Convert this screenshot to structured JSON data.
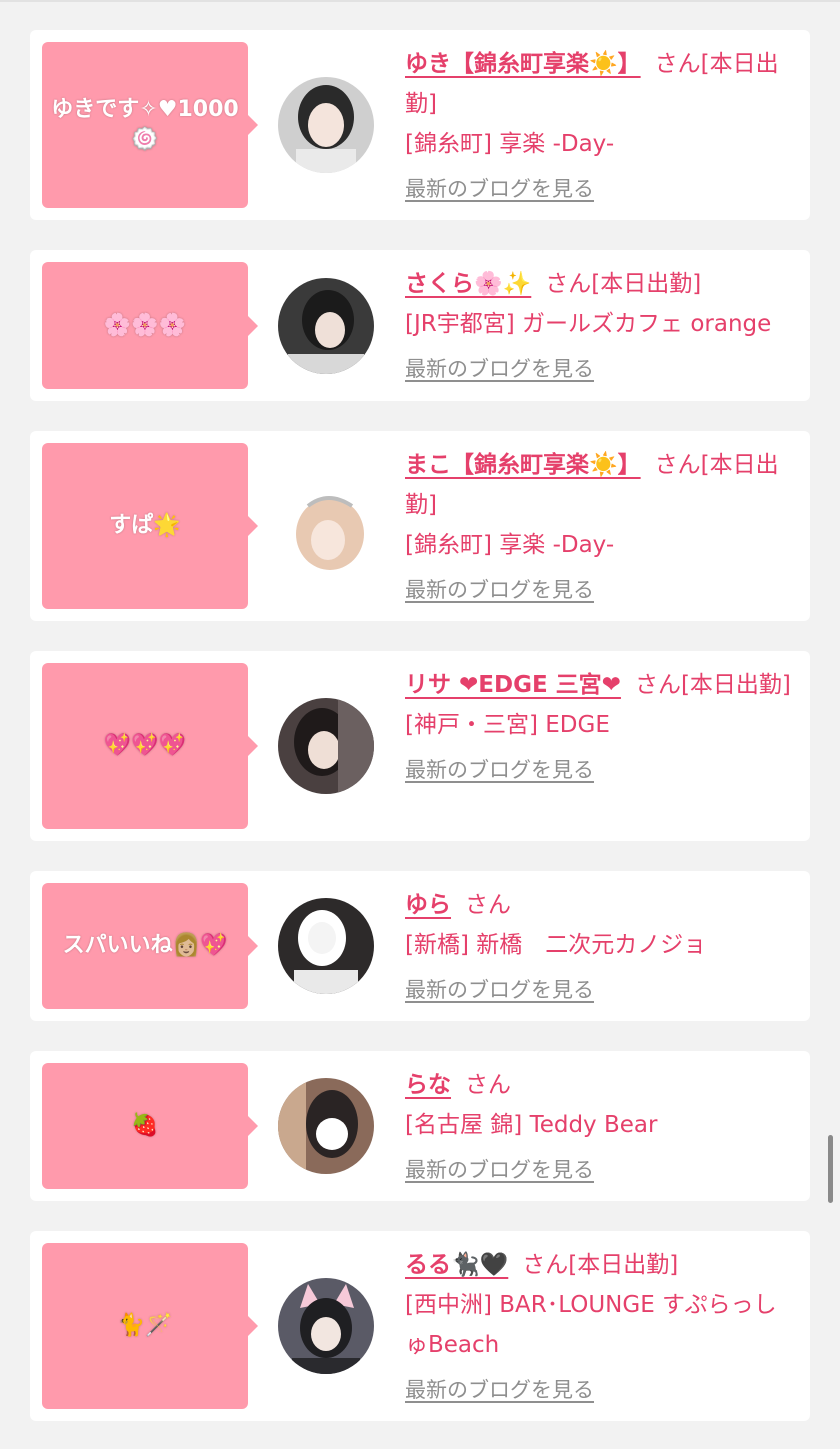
{
  "blog_link_label": "最新のブログを見る",
  "honorific": "さん",
  "cards": [
    {
      "comment": "ゆきです✧♥1000🍥",
      "name": "ゆき【錦糸町享楽☀️】",
      "status": "[本日出勤]",
      "shop": "[錦糸町] 享楽 -Day-",
      "avatar_color": "#cfcfcf"
    },
    {
      "comment": "🌸🌸🌸",
      "name": "さくら🌸✨",
      "status": "[本日出勤]",
      "shop": "[JR宇都宮] ガールズカフェ orange",
      "avatar_color": "#3a3a3a"
    },
    {
      "comment": "すぱ🌟",
      "name": "まこ【錦糸町享楽☀️】",
      "status": "[本日出勤]",
      "shop": "[錦糸町] 享楽 -Day-",
      "avatar_color": "#e8c9b2"
    },
    {
      "comment": "💖💖💖",
      "name": "リサ ❤EDGE 三宮❤",
      "status": "[本日出勤]",
      "shop": "[神戸・三宮] EDGE",
      "avatar_color": "#4a4040"
    },
    {
      "comment": "スパいいね👩🏼💖",
      "name": "ゆら",
      "status": "",
      "shop": "[新橋] 新橋　二次元カノジョ",
      "avatar_color": "#2d2a2a"
    },
    {
      "comment": "🍓",
      "name": "らな",
      "status": "",
      "shop": "[名古屋 錦] Teddy Bear",
      "avatar_color": "#8a6a5a"
    },
    {
      "comment": "🐈🪄",
      "name": "るる🐈‍⬛🖤",
      "status": "[本日出勤]",
      "shop": "[西中洲] BAR･LOUNGE すぷらっしゅBeach",
      "avatar_color": "#5a5a66"
    }
  ]
}
